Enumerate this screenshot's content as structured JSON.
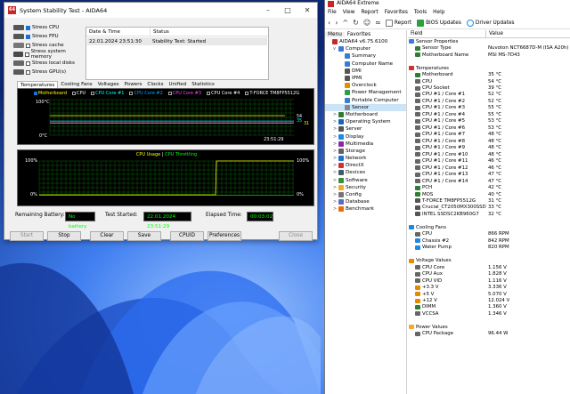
{
  "stability": {
    "title": "System Stability Test - AIDA64",
    "stress_items": [
      {
        "label": "Stress CPU",
        "checked": true,
        "icon_color": "#555555"
      },
      {
        "label": "Stress FPU",
        "checked": true,
        "icon_color": "#555555"
      },
      {
        "label": "Stress cache",
        "checked": false,
        "icon_color": "#777777"
      },
      {
        "label": "Stress system memory",
        "checked": false,
        "icon_color": "#4a4a4a"
      },
      {
        "label": "Stress local disks",
        "checked": false,
        "icon_color": "#666666"
      },
      {
        "label": "Stress GPU(s)",
        "checked": false,
        "icon_color": "#5a5a5a"
      }
    ],
    "status_headers": {
      "date": "Date & Time",
      "status": "Status"
    },
    "status_rows": [
      {
        "date": "22.01.2024 23:51:30",
        "status": "Stability Test: Started"
      }
    ],
    "tabs": [
      "Temperatures",
      "Cooling Fans",
      "Voltages",
      "Powers",
      "Clocks",
      "Unified",
      "Statistics"
    ],
    "active_tab": "Temperatures",
    "temp_legend": [
      {
        "label": "Motherboard",
        "color": "#ffff00",
        "checked": true
      },
      {
        "label": "CPU",
        "color": "#ffffff",
        "checked": false
      },
      {
        "label": "CPU Core #1",
        "color": "#00ffff",
        "checked": false
      },
      {
        "label": "CPU Core #2",
        "color": "#00aaff",
        "checked": false
      },
      {
        "label": "CPU Core #3",
        "color": "#ff44ff",
        "checked": false
      },
      {
        "label": "CPU Core #4",
        "color": "#ffffff",
        "checked": false
      },
      {
        "label": "T-FORCE TM8FP5512G",
        "color": "#ffffff",
        "checked": false
      }
    ],
    "temp_axis": {
      "top": "100°C",
      "bottom": "0°C"
    },
    "temp_time": "23:51:29",
    "temp_values": {
      "v1": "54",
      "v2": "35",
      "v2b": "31"
    },
    "cpu_graph": {
      "usage_label": "CPU Usage",
      "sep": "|",
      "throttle_label": "CPU Throttling",
      "axis_top_left": "100%",
      "axis_bottom_left": "0%",
      "axis_top_right": "100%",
      "axis_bottom_right": "0%",
      "usage_color": "#ffff00",
      "throttle_color": "#00ff00"
    },
    "info": {
      "battery_label": "Remaining Battery:",
      "battery_value": "No battery",
      "started_label": "Test Started:",
      "started_value": "22.01.2024 23:51:29",
      "elapsed_label": "Elapsed Time:",
      "elapsed_value": "00:03:02"
    },
    "buttons": {
      "start": "Start",
      "stop": "Stop",
      "clear": "Clear",
      "save": "Save",
      "cpuid": "CPUID",
      "preferences": "Preferences",
      "close": "Close"
    }
  },
  "aida": {
    "title": "AIDA64 Extreme",
    "menu": [
      "File",
      "View",
      "Report",
      "Favorites",
      "Tools",
      "Help"
    ],
    "toolbar": {
      "report": "Report",
      "bios": "BIOS Updates",
      "driver": "Driver Updates"
    },
    "left_tabs": [
      "Menu",
      "Favorites"
    ],
    "tree": [
      {
        "label": "AIDA64 v6.75.6100",
        "level": 0,
        "toggle": "",
        "color": "#c62828"
      },
      {
        "label": "Computer",
        "level": 1,
        "toggle": "v",
        "color": "#3a7bd5"
      },
      {
        "label": "Summary",
        "level": 2,
        "toggle": "",
        "color": "#3a7bd5"
      },
      {
        "label": "Computer Name",
        "level": 2,
        "toggle": "",
        "color": "#3a7bd5"
      },
      {
        "label": "DMI",
        "level": 2,
        "toggle": "",
        "color": "#555555"
      },
      {
        "label": "IPMI",
        "level": 2,
        "toggle": "",
        "color": "#555555"
      },
      {
        "label": "Overclock",
        "level": 2,
        "toggle": "",
        "color": "#e68a00"
      },
      {
        "label": "Power Management",
        "level": 2,
        "toggle": "",
        "color": "#2e9e3e"
      },
      {
        "label": "Portable Computer",
        "level": 2,
        "toggle": "",
        "color": "#3a7bd5"
      },
      {
        "label": "Sensor",
        "level": 2,
        "toggle": "",
        "color": "#888888",
        "selected": true
      },
      {
        "label": "Motherboard",
        "level": 1,
        "toggle": ">",
        "color": "#2e7d32"
      },
      {
        "label": "Operating System",
        "level": 1,
        "toggle": ">",
        "color": "#1565c0"
      },
      {
        "label": "Server",
        "level": 1,
        "toggle": ">",
        "color": "#555555"
      },
      {
        "label": "Display",
        "level": 1,
        "toggle": ">",
        "color": "#1e88e5"
      },
      {
        "label": "Multimedia",
        "level": 1,
        "toggle": ">",
        "color": "#8e24aa"
      },
      {
        "label": "Storage",
        "level": 1,
        "toggle": ">",
        "color": "#616161"
      },
      {
        "label": "Network",
        "level": 1,
        "toggle": ">",
        "color": "#1976d2"
      },
      {
        "label": "DirectX",
        "level": 1,
        "toggle": ">",
        "color": "#d32f2f"
      },
      {
        "label": "Devices",
        "level": 1,
        "toggle": ">",
        "color": "#455a64"
      },
      {
        "label": "Software",
        "level": 1,
        "toggle": ">",
        "color": "#388e3c"
      },
      {
        "label": "Security",
        "level": 1,
        "toggle": ">",
        "color": "#f9a825"
      },
      {
        "label": "Config",
        "level": 1,
        "toggle": ">",
        "color": "#757575"
      },
      {
        "label": "Database",
        "level": 1,
        "toggle": ">",
        "color": "#5c6bc0"
      },
      {
        "label": "Benchmark",
        "level": 1,
        "toggle": ">",
        "color": "#ef6c00"
      }
    ],
    "headers": {
      "field": "Field",
      "value": "Value"
    },
    "rows": [
      {
        "type": "sec",
        "field": "Sensor Properties",
        "value": "",
        "color": "#3a7bd5"
      },
      {
        "type": "item",
        "field": "Sensor Type",
        "value": "Nuvoton NCT6687D-M  (ISA A20h)",
        "color": "#2e7d32"
      },
      {
        "type": "item",
        "field": "Motherboard Name",
        "value": "MSI MS-7D43",
        "color": "#2e7d32"
      },
      {
        "type": "blank"
      },
      {
        "type": "sec",
        "field": "Temperatures",
        "value": "",
        "color": "#d32f2f"
      },
      {
        "type": "item",
        "field": "Motherboard",
        "value": "35 °C",
        "color": "#2e7d32"
      },
      {
        "type": "item",
        "field": "CPU",
        "value": "54 °C",
        "color": "#666666"
      },
      {
        "type": "item",
        "field": "CPU Socket",
        "value": "39 °C",
        "color": "#666666"
      },
      {
        "type": "item",
        "field": "CPU #1 / Core #1",
        "value": "52 °C",
        "color": "#666666"
      },
      {
        "type": "item",
        "field": "CPU #1 / Core #2",
        "value": "52 °C",
        "color": "#666666"
      },
      {
        "type": "item",
        "field": "CPU #1 / Core #3",
        "value": "55 °C",
        "color": "#666666"
      },
      {
        "type": "item",
        "field": "CPU #1 / Core #4",
        "value": "55 °C",
        "color": "#666666"
      },
      {
        "type": "item",
        "field": "CPU #1 / Core #5",
        "value": "53 °C",
        "color": "#666666"
      },
      {
        "type": "item",
        "field": "CPU #1 / Core #6",
        "value": "53 °C",
        "color": "#666666"
      },
      {
        "type": "item",
        "field": "CPU #1 / Core #7",
        "value": "48 °C",
        "color": "#666666"
      },
      {
        "type": "item",
        "field": "CPU #1 / Core #8",
        "value": "48 °C",
        "color": "#666666"
      },
      {
        "type": "item",
        "field": "CPU #1 / Core #9",
        "value": "48 °C",
        "color": "#666666"
      },
      {
        "type": "item",
        "field": "CPU #1 / Core #10",
        "value": "48 °C",
        "color": "#666666"
      },
      {
        "type": "item",
        "field": "CPU #1 / Core #11",
        "value": "46 °C",
        "color": "#666666"
      },
      {
        "type": "item",
        "field": "CPU #1 / Core #12",
        "value": "46 °C",
        "color": "#666666"
      },
      {
        "type": "item",
        "field": "CPU #1 / Core #13",
        "value": "47 °C",
        "color": "#666666"
      },
      {
        "type": "item",
        "field": "CPU #1 / Core #14",
        "value": "47 °C",
        "color": "#666666"
      },
      {
        "type": "item",
        "field": "PCH",
        "value": "42 °C",
        "color": "#2e7d32"
      },
      {
        "type": "item",
        "field": "MOS",
        "value": "40 °C",
        "color": "#2e7d32"
      },
      {
        "type": "item",
        "field": "T-FORCE TM8FP5512G",
        "value": "31 °C",
        "color": "#555555"
      },
      {
        "type": "item",
        "field": "Crucial_CT2050MX300SSD1",
        "value": "33 °C",
        "color": "#555555"
      },
      {
        "type": "item",
        "field": "INTEL SSDSC2KB960G7",
        "value": "32 °C",
        "color": "#555555"
      },
      {
        "type": "blank"
      },
      {
        "type": "sec",
        "field": "Cooling Fans",
        "value": "",
        "color": "#1e88e5"
      },
      {
        "type": "item",
        "field": "CPU",
        "value": "866 RPM",
        "color": "#666666"
      },
      {
        "type": "item",
        "field": "Chassis #2",
        "value": "842 RPM",
        "color": "#1e88e5"
      },
      {
        "type": "item",
        "field": "Water Pump",
        "value": "820 RPM",
        "color": "#1e88e5"
      },
      {
        "type": "blank"
      },
      {
        "type": "sec",
        "field": "Voltage Values",
        "value": "",
        "color": "#e68a00"
      },
      {
        "type": "item",
        "field": "CPU Core",
        "value": "1.156 V",
        "color": "#666666"
      },
      {
        "type": "item",
        "field": "CPU Aux",
        "value": "1.828 V",
        "color": "#666666"
      },
      {
        "type": "item",
        "field": "CPU VID",
        "value": "1.116 V",
        "color": "#666666"
      },
      {
        "type": "item",
        "field": "+3.3 V",
        "value": "3.336 V",
        "color": "#e68a00"
      },
      {
        "type": "item",
        "field": "+5 V",
        "value": "5.070 V",
        "color": "#e68a00"
      },
      {
        "type": "item",
        "field": "+12 V",
        "value": "12.024 V",
        "color": "#e68a00"
      },
      {
        "type": "item",
        "field": "DIMM",
        "value": "1.360 V",
        "color": "#2e7d32"
      },
      {
        "type": "item",
        "field": "VCCSA",
        "value": "1.346 V",
        "color": "#666666"
      },
      {
        "type": "blank"
      },
      {
        "type": "sec",
        "field": "Power Values",
        "value": "",
        "color": "#f9a825"
      },
      {
        "type": "item",
        "field": "CPU Package",
        "value": "96.44 W",
        "color": "#666666"
      }
    ]
  }
}
